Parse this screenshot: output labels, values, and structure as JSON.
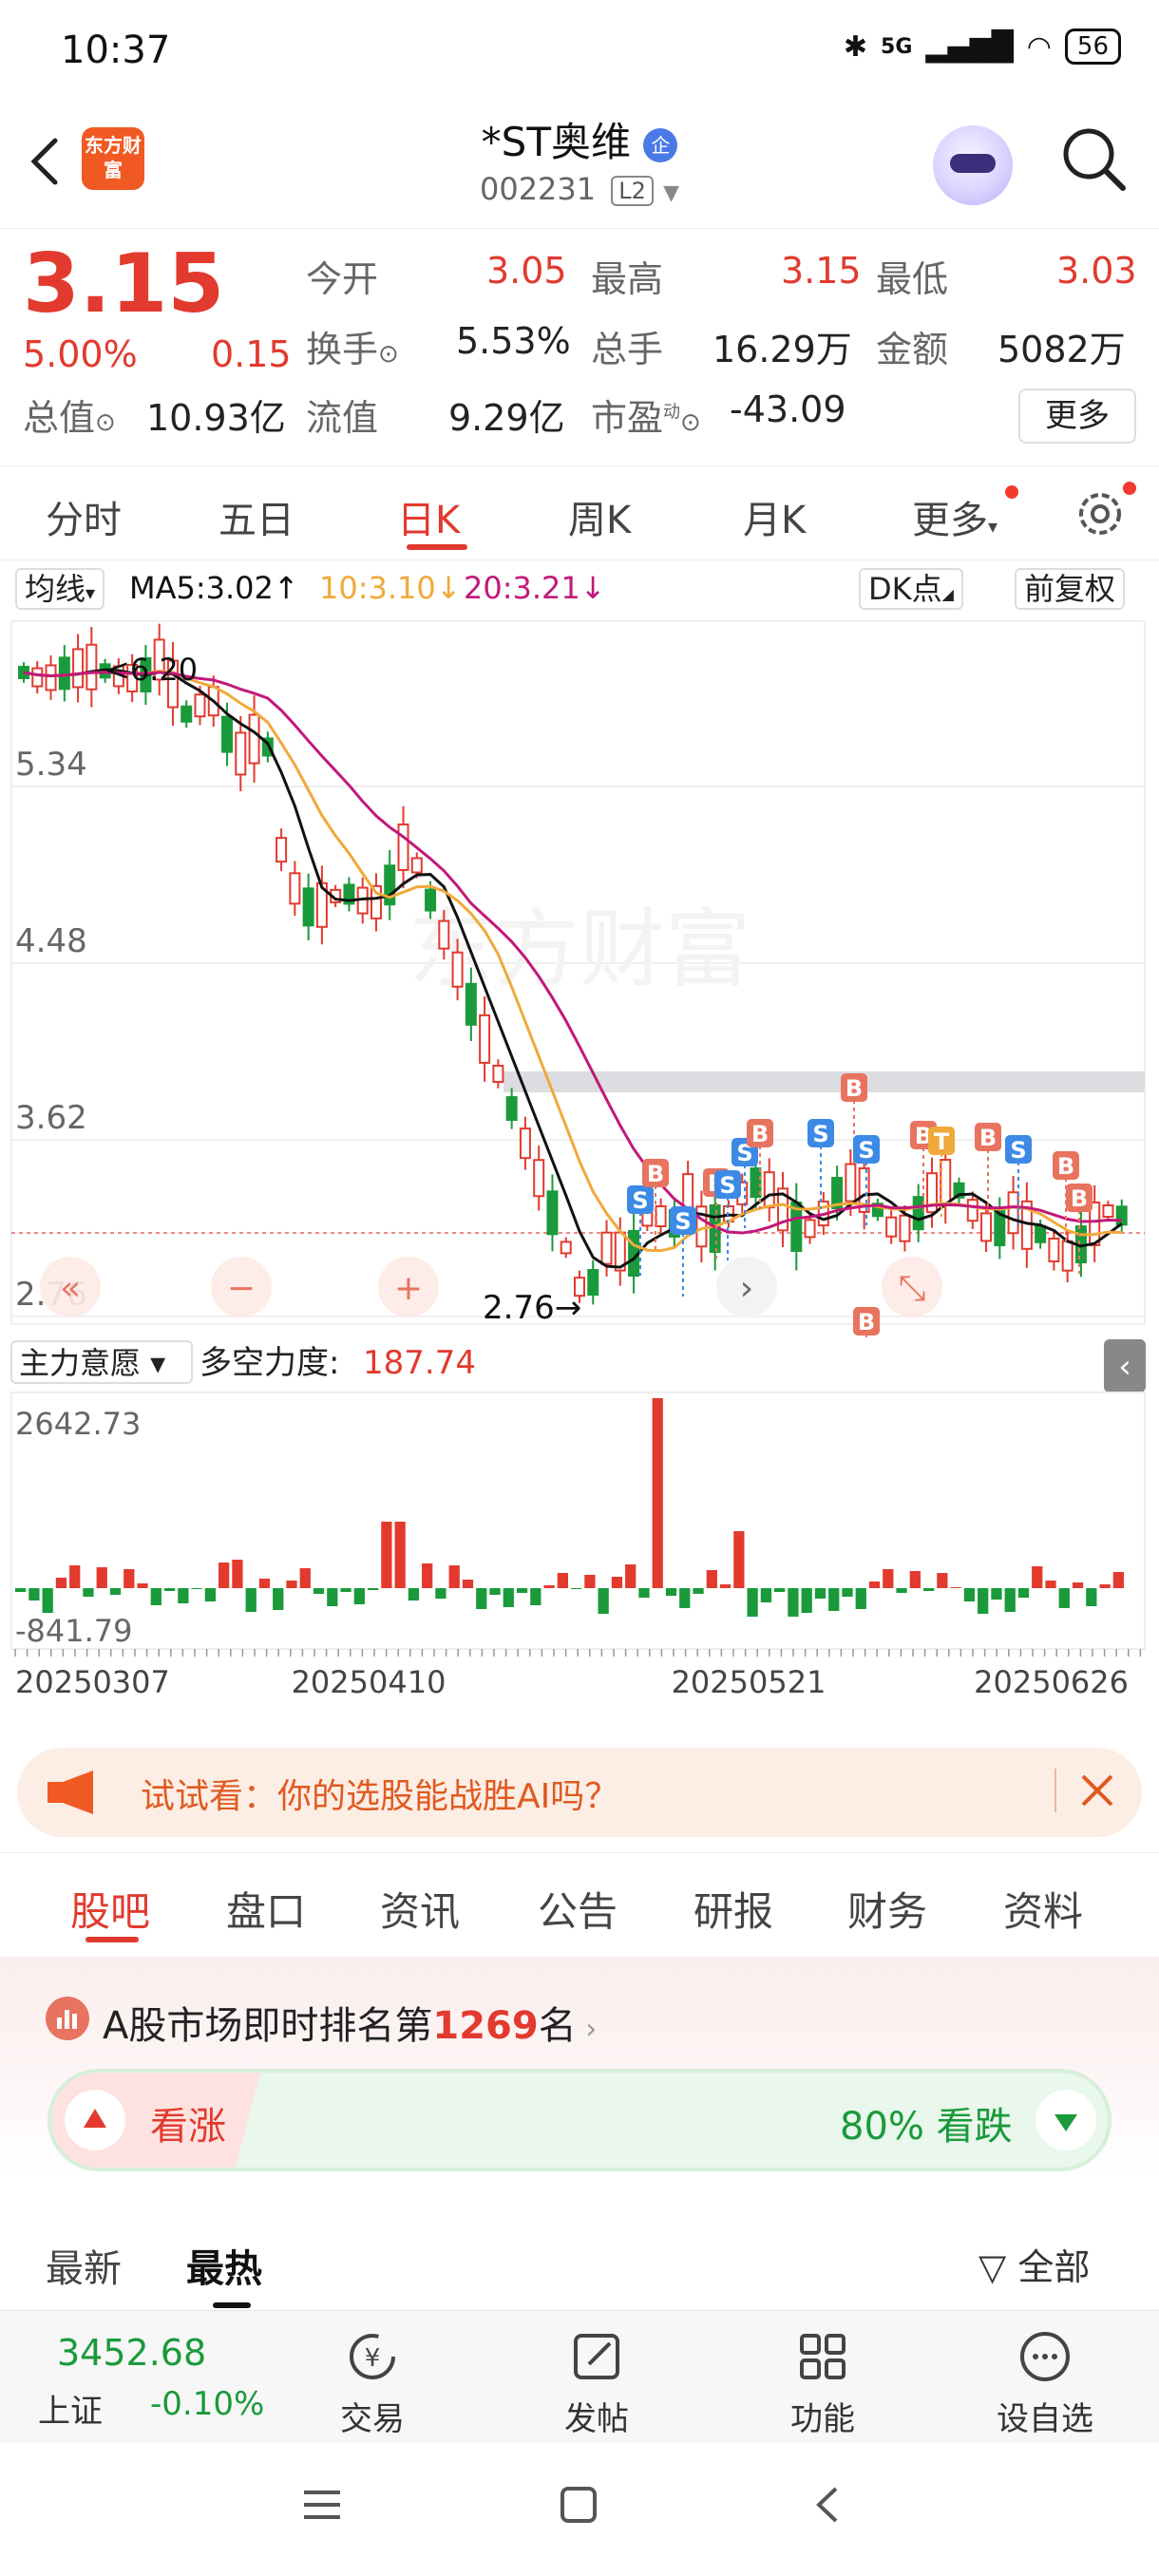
{
  "status_bar": {
    "time": "10:37",
    "network": "5G",
    "battery": "56"
  },
  "header": {
    "logo_text": "东方财富",
    "title": "*ST奥维",
    "title_badge": "企",
    "code": "002231",
    "level_badge": "L2"
  },
  "quote": {
    "price": "3.15",
    "change_pct": "5.00%",
    "change": "0.15",
    "fields": {
      "open_label": "今开",
      "open": "3.05",
      "high_label": "最高",
      "high": "3.15",
      "low_label": "最低",
      "low": "3.03",
      "turnover_label": "换手",
      "turnover": "5.53%",
      "volume_label": "总手",
      "volume": "16.29万",
      "amount_label": "金额",
      "amount": "5082万",
      "mktcap_label": "总值",
      "mktcap": "10.93亿",
      "float_label": "流值",
      "float": "9.29亿",
      "pe_label": "市盈",
      "pe_sup": "动",
      "pe": "-43.09"
    },
    "more_button": "更多"
  },
  "period_tabs": [
    "分时",
    "五日",
    "日K",
    "周K",
    "月K",
    "更多"
  ],
  "active_period": "日K",
  "ma_legend": {
    "selector": "均线",
    "ma5": "MA5:3.02↑",
    "ma10": "10:3.10↓",
    "ma20": "20:3.21↓",
    "dk_button": "DK点",
    "adjust_button": "前复权",
    "color_ma5": "#111111",
    "color_ma10": "#f0a93a",
    "color_ma20": "#c2187a"
  },
  "chart_data": [
    {
      "type": "candlestick",
      "y_ticks": [
        "5.34",
        "4.48",
        "3.62",
        "2.76"
      ],
      "high_annotation": "6.20",
      "low_annotation": "2.76",
      "signals": [
        "S",
        "B",
        "S",
        "B",
        "S",
        "S",
        "B",
        "S",
        "B",
        "S",
        "B",
        "T",
        "B",
        "S",
        "B",
        "B",
        "B"
      ]
    },
    {
      "type": "bar",
      "indicator_selector": "主力意愿",
      "indicator_label": "多空力度:",
      "indicator_value": "187.74",
      "y_max_label": "2642.73",
      "y_min_label": "-841.79",
      "x_labels": [
        "20250307",
        "20250410",
        "20250521",
        "20250626"
      ]
    }
  ],
  "banner": {
    "text": "试试看：你的选股能战胜AI吗？"
  },
  "content_tabs": [
    "股吧",
    "盘口",
    "资讯",
    "公告",
    "研报",
    "财务",
    "资料"
  ],
  "active_content_tab": "股吧",
  "rank": {
    "prefix": "A股市场即时排名第",
    "number": "1269",
    "suffix": "名"
  },
  "sentiment": {
    "bull_label": "看涨",
    "bear_label": "80% 看跌"
  },
  "sub_tabs": {
    "latest": "最新",
    "hot": "最热",
    "filter": "全部"
  },
  "bottom_nav": {
    "index_value": "3452.68",
    "index_name": "上证",
    "index_change": "-0.10%",
    "trade": "交易",
    "post": "发帖",
    "func": "功能",
    "watch": "设自选"
  }
}
